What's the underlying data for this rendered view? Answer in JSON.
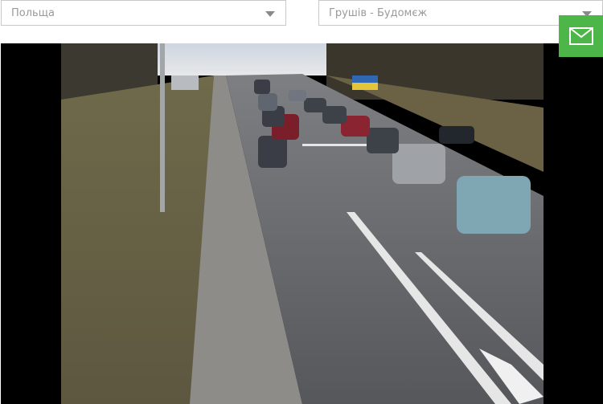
{
  "filters": {
    "country": {
      "value": "Польща",
      "icon": "chevron-down-icon"
    },
    "crossing": {
      "value": "Грушів - Будомєж",
      "icon": "chevron-down-icon"
    }
  },
  "actions": {
    "contact_icon": "mail-icon",
    "accent_color": "#4cb748"
  },
  "camera": {
    "billboard_text_visible": false
  }
}
